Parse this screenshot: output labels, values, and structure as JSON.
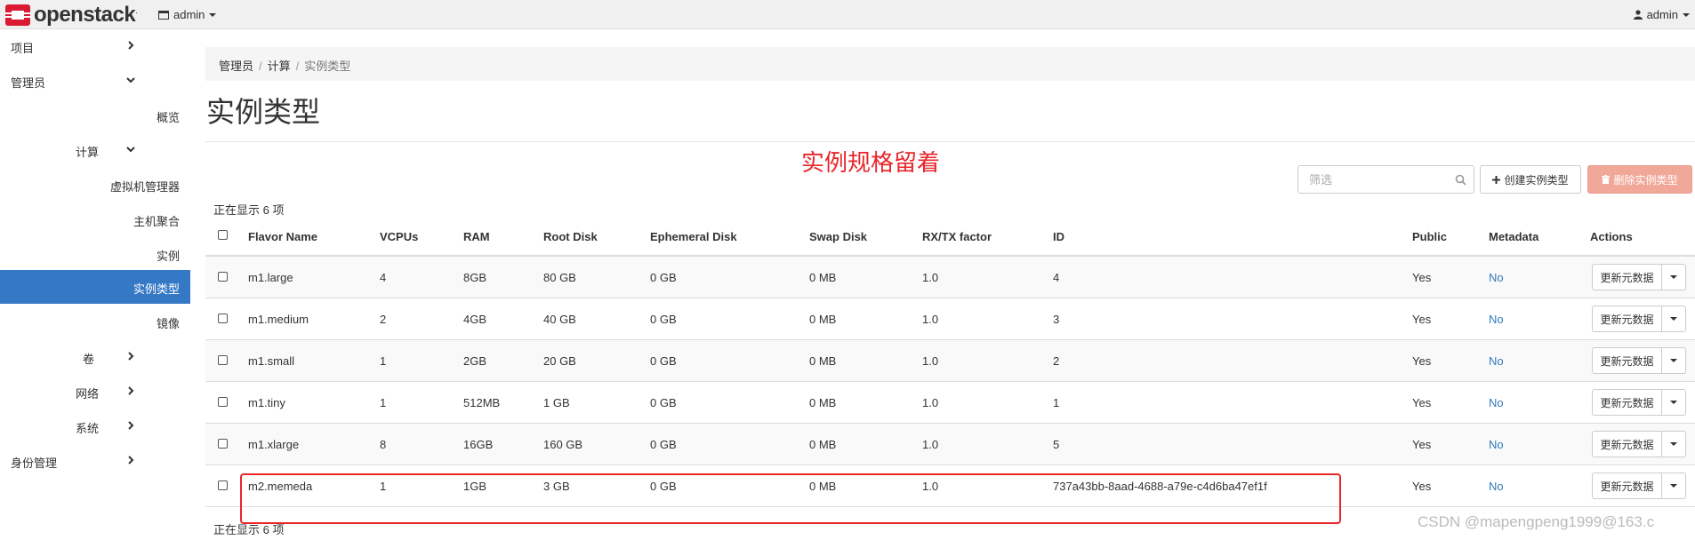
{
  "navbar": {
    "brand": "openstack",
    "brand_mark": ".",
    "project_selector": "admin",
    "user": "admin",
    "colors": {
      "brand_red": "#da1a32"
    }
  },
  "sidebar": {
    "items": [
      {
        "label": "项目",
        "icon": "chevron-right-icon"
      },
      {
        "label": "管理员",
        "icon": "chevron-down-icon"
      },
      {
        "label": "概览"
      },
      {
        "label": "计算",
        "icon": "chevron-down-icon"
      },
      {
        "label": "虚拟机管理器"
      },
      {
        "label": "主机聚合"
      },
      {
        "label": "实例"
      },
      {
        "label": "实例类型",
        "active": true
      },
      {
        "label": "镜像"
      },
      {
        "label": "卷",
        "icon": "chevron-right-icon"
      },
      {
        "label": "网络",
        "icon": "chevron-right-icon"
      },
      {
        "label": "系统",
        "icon": "chevron-right-icon"
      },
      {
        "label": "身份管理",
        "icon": "chevron-right-icon"
      }
    ],
    "active_color": "#3579c6"
  },
  "breadcrumb": [
    "管理员",
    "计算",
    "实例类型"
  ],
  "page_title": "实例类型",
  "annotation": "实例规格留着",
  "toolbar": {
    "filter_placeholder": "筛选",
    "create_label": "创建实例类型",
    "delete_label": "删除实例类型"
  },
  "table": {
    "count_text": "正在显示 6 项",
    "headers": [
      "Flavor Name",
      "VCPUs",
      "RAM",
      "Root Disk",
      "Ephemeral Disk",
      "Swap Disk",
      "RX/TX factor",
      "ID",
      "Public",
      "Metadata",
      "Actions"
    ],
    "action_label": "更新元数据",
    "rows": [
      {
        "name": "m1.large",
        "vcpus": "4",
        "ram": "8GB",
        "root": "80 GB",
        "eph": "0 GB",
        "swap": "0 MB",
        "rxtx": "1.0",
        "id": "4",
        "public": "Yes",
        "metadata": "No"
      },
      {
        "name": "m1.medium",
        "vcpus": "2",
        "ram": "4GB",
        "root": "40 GB",
        "eph": "0 GB",
        "swap": "0 MB",
        "rxtx": "1.0",
        "id": "3",
        "public": "Yes",
        "metadata": "No"
      },
      {
        "name": "m1.small",
        "vcpus": "1",
        "ram": "2GB",
        "root": "20 GB",
        "eph": "0 GB",
        "swap": "0 MB",
        "rxtx": "1.0",
        "id": "2",
        "public": "Yes",
        "metadata": "No"
      },
      {
        "name": "m1.tiny",
        "vcpus": "1",
        "ram": "512MB",
        "root": "1 GB",
        "eph": "0 GB",
        "swap": "0 MB",
        "rxtx": "1.0",
        "id": "1",
        "public": "Yes",
        "metadata": "No"
      },
      {
        "name": "m1.xlarge",
        "vcpus": "8",
        "ram": "16GB",
        "root": "160 GB",
        "eph": "0 GB",
        "swap": "0 MB",
        "rxtx": "1.0",
        "id": "5",
        "public": "Yes",
        "metadata": "No"
      },
      {
        "name": "m2.memeda",
        "vcpus": "1",
        "ram": "1GB",
        "root": "3 GB",
        "eph": "0 GB",
        "swap": "0 MB",
        "rxtx": "1.0",
        "id": "737a43bb-8aad-4688-a79e-c4d6ba47ef1f",
        "public": "Yes",
        "metadata": "No"
      }
    ]
  },
  "watermark": "CSDN @mapengpeng1999@163.c"
}
